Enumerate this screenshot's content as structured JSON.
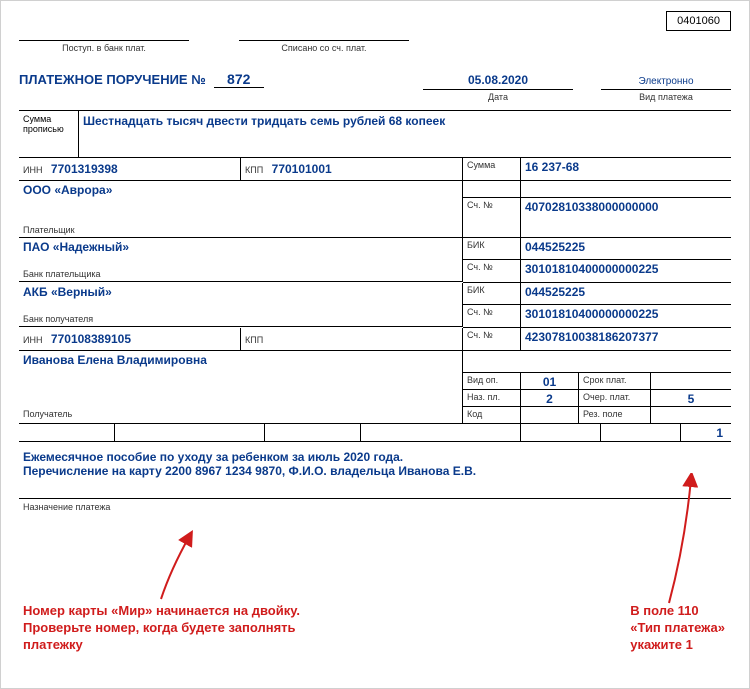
{
  "form_code": "0401060",
  "header": {
    "postup_label": "Поступ. в банк плат.",
    "spisano_label": "Списано со сч. плат."
  },
  "title_prefix": "ПЛАТЕЖНОЕ ПОРУЧЕНИЕ №",
  "title_number": "872",
  "date_value": "05.08.2020",
  "date_label": "Дата",
  "vid_value": "Электронно",
  "vid_label": "Вид платежа",
  "sum_words_label": "Сумма\nпрописью",
  "sum_words": "Шестнадцать тысяч двести тридцать семь рублей 68 копеек",
  "payer": {
    "inn_label": "ИНН",
    "inn": "7701319398",
    "kpp_label": "КПП",
    "kpp": "770101001",
    "name": "ООО «Аврора»",
    "sum_label": "Сумма",
    "sum": "16 237-68",
    "schno_label": "Сч. №",
    "schno": "40702810338000000000",
    "payer_label": "Плательщик"
  },
  "bank1": {
    "name": "ПАО «Надежный»",
    "bik_label": "БИК",
    "bik": "044525225",
    "schno_label": "Сч. №",
    "schno": "30101810400000000225",
    "label": "Банк плательщика"
  },
  "bank2": {
    "name": "АКБ «Верный»",
    "bik_label": "БИК",
    "bik": "044525225",
    "schno_label": "Сч. №",
    "schno": "30101810400000000225",
    "label": "Банк получателя"
  },
  "recipient": {
    "inn_label": "ИНН",
    "inn": "770108389105",
    "kpp_label": "КПП",
    "kpp": "",
    "schno_label": "Сч. №",
    "schno": "42307810038186207377",
    "name": "Иванова Елена Владимировна",
    "vidop_label": "Вид оп.",
    "vidop": "01",
    "nazpl_label": "Наз. пл.",
    "nazpl": "2",
    "kod_label": "Код",
    "srok_label": "Срок плат.",
    "ocher_label": "Очер. плат.",
    "ocher": "5",
    "rez_label": "Рез. поле",
    "recipient_label": "Получатель"
  },
  "field110": "1",
  "purpose_line1": "Ежемесячное пособие по уходу за ребенком за июль 2020 года.",
  "purpose_line2": "Перечисление на карту 2200 8967 1234 9870,  Ф.И.О. владельца Иванова Е.В.",
  "purpose_label": "Назначение платежа",
  "callout_left_1": "Номер карты «Мир» начинается на двойку.",
  "callout_left_2": "Проверьте номер, когда будете заполнять",
  "callout_left_3": "платежку",
  "callout_right_1": "В поле 110",
  "callout_right_2": "«Тип платежа»",
  "callout_right_3": "укажите 1"
}
